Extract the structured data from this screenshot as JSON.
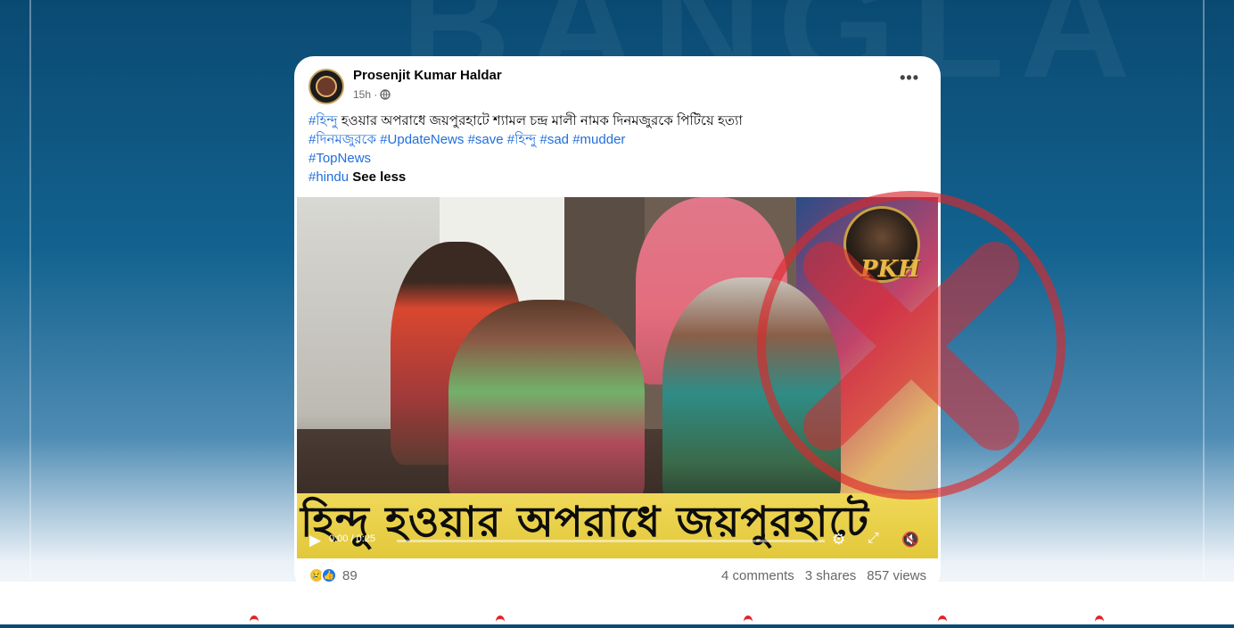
{
  "background": {
    "watermark": "BANGLA",
    "accent_color": "#e0262a"
  },
  "post": {
    "author": "Prosenjit Kumar Haldar",
    "time": "15h ·",
    "globe_icon": "globe-icon",
    "more_label": "•••",
    "line1": {
      "tag": "#হিন্দু",
      "text": "হওয়ার অপরাধে জয়পুরহাটে শ্যামল চন্দ্র মালী নামক দিনমজুরকে পিটিয়ে হত্যা"
    },
    "line2": {
      "tag1": "#দিনমজুরকে",
      "tag2": "#UpdateNews",
      "tag3": "#save",
      "tag4": "#হিন্দু",
      "tag5": "#sad",
      "tag6": "#mudder"
    },
    "line3": {
      "tag": "#TopNews"
    },
    "line4": {
      "tag": "#hindu",
      "see_less": "See less"
    },
    "video": {
      "logo_text": "PKH",
      "caption": "হিন্দু হওয়ার অপরাধে জয়পুরহাটে",
      "time": "0:00 / 0:25",
      "progress": 0
    },
    "reactions": {
      "icons": [
        "sad-icon",
        "like-icon"
      ],
      "count": "89"
    },
    "stats": {
      "comments": "4 comments",
      "shares": "3 shares",
      "views": "857 views"
    }
  }
}
